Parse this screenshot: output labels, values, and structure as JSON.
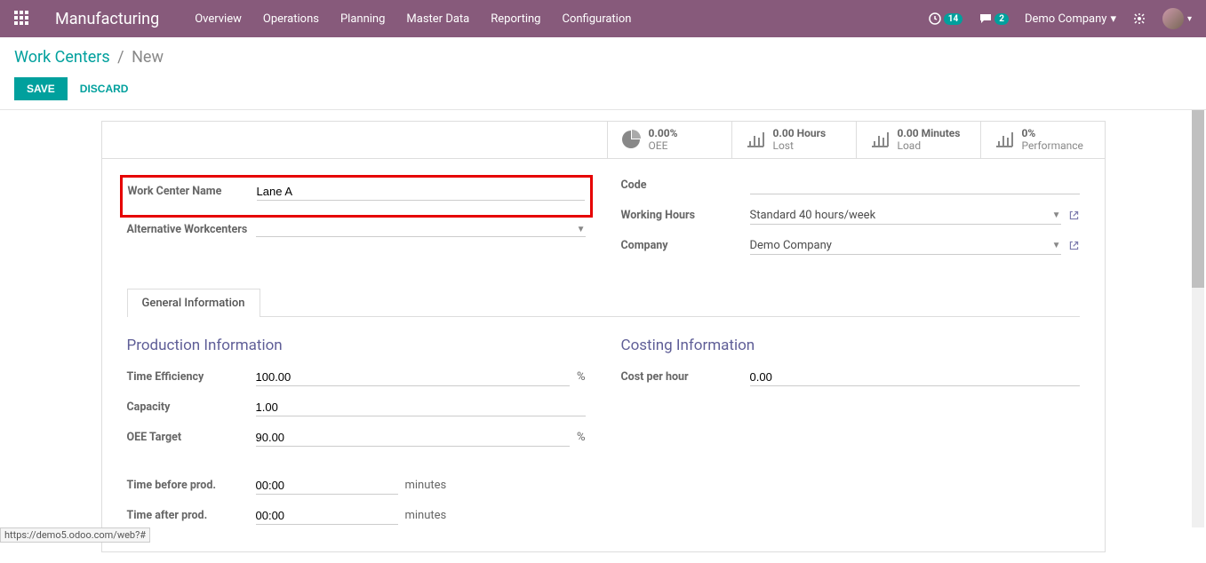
{
  "nav": {
    "app_title": "Manufacturing",
    "items": [
      "Overview",
      "Operations",
      "Planning",
      "Master Data",
      "Reporting",
      "Configuration"
    ],
    "clock_badge": "14",
    "chat_badge": "2",
    "company": "Demo Company"
  },
  "breadcrumb": {
    "parent": "Work Centers",
    "current": "New"
  },
  "buttons": {
    "save": "SAVE",
    "discard": "DISCARD"
  },
  "stats": [
    {
      "icon": "pie",
      "value": "0.00%",
      "label": "OEE"
    },
    {
      "icon": "bar",
      "value": "0.00 Hours",
      "label": "Lost"
    },
    {
      "icon": "bar",
      "value": "0.00 Minutes",
      "label": "Load"
    },
    {
      "icon": "bar",
      "value": "0%",
      "label": "Performance"
    }
  ],
  "fields_left": {
    "work_center_name_label": "Work Center Name",
    "work_center_name_value": "Lane A",
    "alt_wc_label": "Alternative Workcenters"
  },
  "fields_right": {
    "code_label": "Code",
    "working_hours_label": "Working Hours",
    "working_hours_value": "Standard 40 hours/week",
    "company_label": "Company",
    "company_value": "Demo Company"
  },
  "tab": {
    "general_info": "General Information"
  },
  "production": {
    "title": "Production Information",
    "time_efficiency_label": "Time Efficiency",
    "time_efficiency_value": "100.00",
    "time_efficiency_unit": "%",
    "capacity_label": "Capacity",
    "capacity_value": "1.00",
    "oee_target_label": "OEE Target",
    "oee_target_value": "90.00",
    "oee_target_unit": "%",
    "time_before_label": "Time before prod.",
    "time_before_value": "00:00",
    "time_before_unit": "minutes",
    "time_after_label": "Time after prod.",
    "time_after_value": "00:00",
    "time_after_unit": "minutes"
  },
  "costing": {
    "title": "Costing Information",
    "cost_per_hour_label": "Cost per hour",
    "cost_per_hour_value": "0.00"
  },
  "status_url": "https://demo5.odoo.com/web?#"
}
